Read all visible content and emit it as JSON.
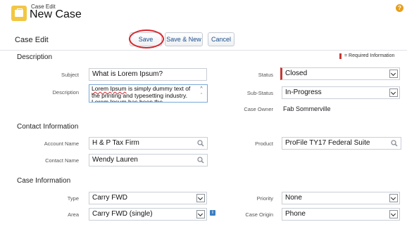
{
  "header": {
    "subtitle": "Case Edit",
    "title": "New Case",
    "help_icon": "help-icon"
  },
  "toolbar": {
    "title": "Case Edit",
    "save_label": "Save",
    "save_new_label": "Save & New",
    "cancel_label": "Cancel"
  },
  "colors": {
    "accent": "#1a4f8a",
    "required": "#c23934",
    "highlight_ring": "#d9262c",
    "icon_yellow": "#f2c744"
  },
  "sections": {
    "description": {
      "title": "Description",
      "required_note": "= Required Information",
      "subject_label": "Subject",
      "subject_value": "What is Lorem Ipsum?",
      "description_label": "Description",
      "description_word": "Lorem Ipsum",
      "description_value_rest": " is simply dummy text of the printing and typesetting industry. Lorem Ipsum has been the",
      "status_label": "Status",
      "status_value": "Closed",
      "substatus_label": "Sub-Status",
      "substatus_value": "In-Progress",
      "owner_label": "Case Owner",
      "owner_value": "Fab Sommerville"
    },
    "contact": {
      "title": "Contact Information",
      "account_label": "Account Name",
      "account_value": "H & P Tax Firm",
      "contact_label": "Contact Name",
      "contact_value": "Wendy Lauren",
      "product_label": "Product",
      "product_value": "ProFile TY17 Federal Suite"
    },
    "case_info": {
      "title": "Case Information",
      "type_label": "Type",
      "type_value": "Carry FWD",
      "area_label": "Area",
      "area_value": "Carry FWD (single)",
      "priority_label": "Priority",
      "priority_value": "None",
      "origin_label": "Case Origin",
      "origin_value": "Phone",
      "info_icon_text": "i"
    }
  }
}
